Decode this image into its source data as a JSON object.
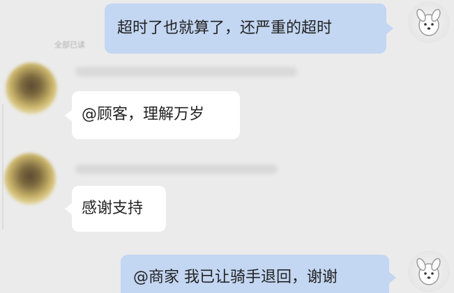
{
  "messages": [
    {
      "side": "out",
      "text": "超时了也就算了，还严重的超时",
      "avatar_icon": "cartoon-dog-avatar-icon"
    },
    {
      "side": "in",
      "text": "@顾客，理解万岁",
      "avatar_icon": "blurred-user-avatar-icon"
    },
    {
      "side": "in",
      "text": "感谢支持",
      "avatar_icon": "blurred-user-avatar-icon"
    },
    {
      "side": "out",
      "text": "@商家 我已让骑手退回，谢谢",
      "avatar_icon": "cartoon-dog-avatar-icon"
    }
  ],
  "read_status": "全部已读",
  "colors": {
    "background": "#ebebeb",
    "outgoing_bubble": "#c3d6f2",
    "incoming_bubble": "#ffffff"
  }
}
